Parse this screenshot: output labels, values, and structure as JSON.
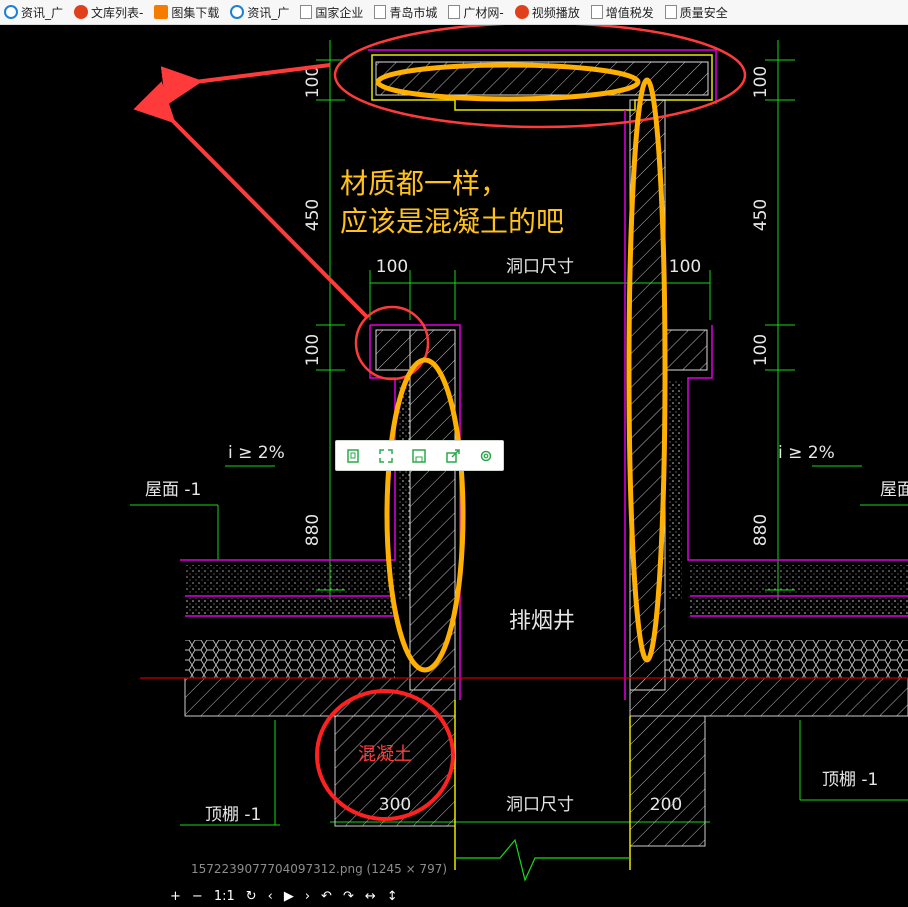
{
  "bookmarks": [
    {
      "label": "资讯_广",
      "icon": "ie-icon"
    },
    {
      "label": "文库列表-",
      "icon": "red-logo-icon"
    },
    {
      "label": "图集下载",
      "icon": "orange-logo-icon"
    },
    {
      "label": "资讯_广",
      "icon": "ie-icon"
    },
    {
      "label": "国家企业",
      "icon": "page-icon"
    },
    {
      "label": "青岛市城",
      "icon": "page-icon"
    },
    {
      "label": "广材网-",
      "icon": "page-icon"
    },
    {
      "label": "视频播放",
      "icon": "red-logo-icon"
    },
    {
      "label": "增值税发",
      "icon": "page-icon"
    },
    {
      "label": "质量安全",
      "icon": "page-icon"
    }
  ],
  "drawing": {
    "dims": {
      "d100_top_left": "100",
      "d100_top_right": "100",
      "d450_left": "450",
      "d450_right": "450",
      "w100_left": "100",
      "w100_right": "100",
      "opening_top": "洞口尺寸",
      "d100_mid_left": "100",
      "d100_mid_right": "100",
      "slope_left": "i ≥ 2%",
      "slope_right": "i ≥ 2%",
      "d880_left": "880",
      "d880_right": "880",
      "roof_left": "屋面 -1",
      "roof_right": "屋面",
      "shaft": "排烟井",
      "ceiling_left": "顶棚 -1",
      "ceiling_right": "顶棚 -1",
      "w300": "300",
      "opening_bottom": "洞口尺寸",
      "w200": "200"
    },
    "annotation": {
      "line1": "材质都一样，",
      "line2": "应该是混凝土的吧",
      "circle_label": "混凝土"
    }
  },
  "viewer": {
    "filename": "1572239077704097312.png (1245 × 797)",
    "controls": [
      "+",
      "−",
      "1:1",
      "↻",
      "‹",
      "▶",
      "›",
      "↶",
      "↷",
      "↔",
      "↕"
    ]
  },
  "colors": {
    "cad_green": "#19d919",
    "cad_magenta": "#e000e0",
    "cad_yellow": "#e8e800",
    "annotation_orange": "#ffb000",
    "annotation_red": "#ff3a3a"
  }
}
